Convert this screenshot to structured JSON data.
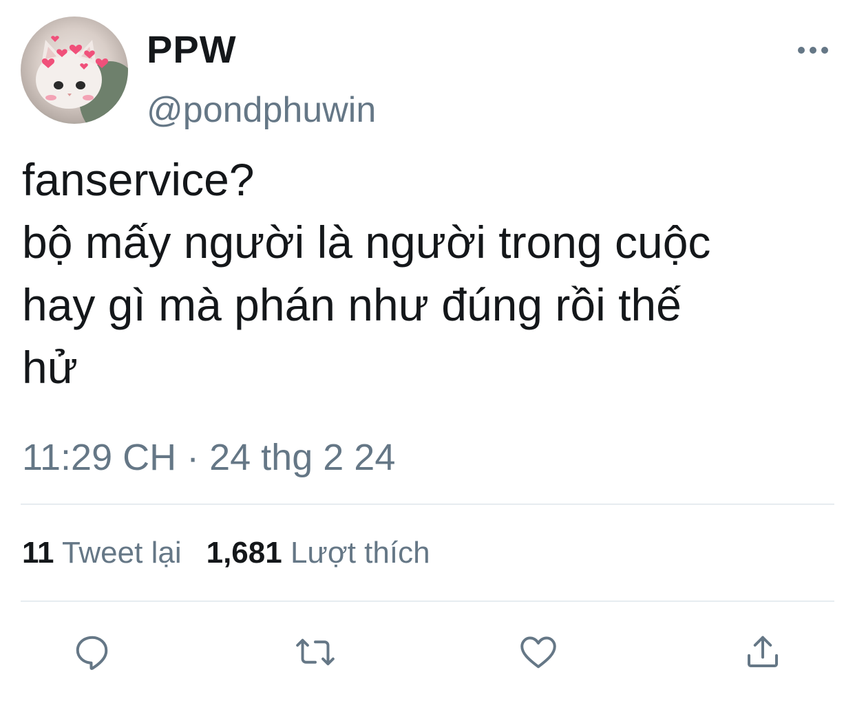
{
  "author": {
    "display_name": "PPW",
    "handle": "@pondphuwin",
    "avatar_icon": "cat-with-hearts-avatar"
  },
  "more_icon": "more-horizontal-icon",
  "tweet": {
    "lines": [
      "fanservice?",
      "bộ mấy người là người trong cuộc",
      "hay gì mà phán như đúng rồi thế",
      "hử"
    ],
    "timestamp": "11:29 CH · 24 thg 2 24"
  },
  "stats": {
    "retweets_count": "11",
    "retweets_label": "Tweet lại",
    "likes_count": "1,681",
    "likes_label": "Lượt thích"
  },
  "actions": [
    {
      "icon": "reply-icon"
    },
    {
      "icon": "retweet-icon"
    },
    {
      "icon": "like-heart-icon"
    },
    {
      "icon": "share-icon"
    }
  ],
  "colors": {
    "text_primary": "#14171a",
    "text_secondary": "#657786",
    "icon": "#657786",
    "divider": "#e6ecf0",
    "avatar_hearts": "#f0507a"
  }
}
